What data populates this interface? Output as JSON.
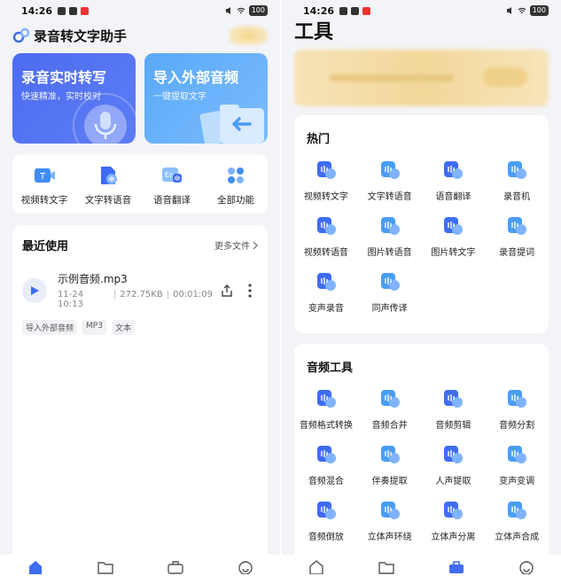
{
  "status": {
    "time": "14:26",
    "battery": "100"
  },
  "left": {
    "app_title": "录音转文字助手",
    "cards": [
      {
        "title": "录音实时转写",
        "subtitle": "快速精准，实时校对"
      },
      {
        "title": "导入外部音频",
        "subtitle": "一键提取文字"
      }
    ],
    "quick": [
      {
        "label": "视频转文字",
        "icon": "video-to-text-icon"
      },
      {
        "label": "文字转语音",
        "icon": "text-to-speech-icon"
      },
      {
        "label": "语音翻译",
        "icon": "voice-translate-icon"
      },
      {
        "label": "全部功能",
        "icon": "all-features-icon"
      }
    ],
    "recent": {
      "title": "最近使用",
      "more": "更多文件",
      "file": {
        "name": "示例音频.mp3",
        "date": "11-24 10:13",
        "size": "272.75KB",
        "duration": "00:01:09",
        "tags": [
          "导入外部音频",
          "MP3",
          "文本"
        ]
      }
    }
  },
  "right": {
    "title": "工具",
    "hot": {
      "title": "热门",
      "items": [
        {
          "label": "视频转文字",
          "icon": "video-to-text-icon"
        },
        {
          "label": "文字转语音",
          "icon": "text-to-speech-icon"
        },
        {
          "label": "语音翻译",
          "icon": "voice-translate-icon"
        },
        {
          "label": "录音机",
          "icon": "recorder-icon"
        },
        {
          "label": "视频转语音",
          "icon": "video-to-audio-icon"
        },
        {
          "label": "图片转语音",
          "icon": "image-to-audio-icon"
        },
        {
          "label": "图片转文字",
          "icon": "image-to-text-icon"
        },
        {
          "label": "录音提词",
          "icon": "teleprompter-icon"
        },
        {
          "label": "变声录音",
          "icon": "voice-changer-record-icon"
        },
        {
          "label": "同声传译",
          "icon": "interpretation-icon"
        }
      ]
    },
    "audio": {
      "title": "音频工具",
      "items": [
        {
          "label": "音频格式转换",
          "icon": "format-convert-icon"
        },
        {
          "label": "音频合并",
          "icon": "audio-merge-icon"
        },
        {
          "label": "音频剪辑",
          "icon": "audio-cut-icon"
        },
        {
          "label": "音频分割",
          "icon": "audio-split-icon"
        },
        {
          "label": "音频混合",
          "icon": "audio-mix-icon"
        },
        {
          "label": "伴奏提取",
          "icon": "accompaniment-extract-icon"
        },
        {
          "label": "人声提取",
          "icon": "vocal-extract-icon"
        },
        {
          "label": "变声变调",
          "icon": "pitch-change-icon"
        },
        {
          "label": "音频倒放",
          "icon": "audio-reverse-icon"
        },
        {
          "label": "立体声环绕",
          "icon": "stereo-surround-icon"
        },
        {
          "label": "立体声分离",
          "icon": "stereo-separate-icon"
        },
        {
          "label": "立体声合成",
          "icon": "stereo-compose-icon"
        }
      ]
    }
  },
  "colors": {
    "primary": "#3f6cf2",
    "light_blue": "#7fb3ff",
    "card_blue": "#4e6cf0",
    "card_sky": "#5aa9f8",
    "bg": "#f3f4f7"
  }
}
